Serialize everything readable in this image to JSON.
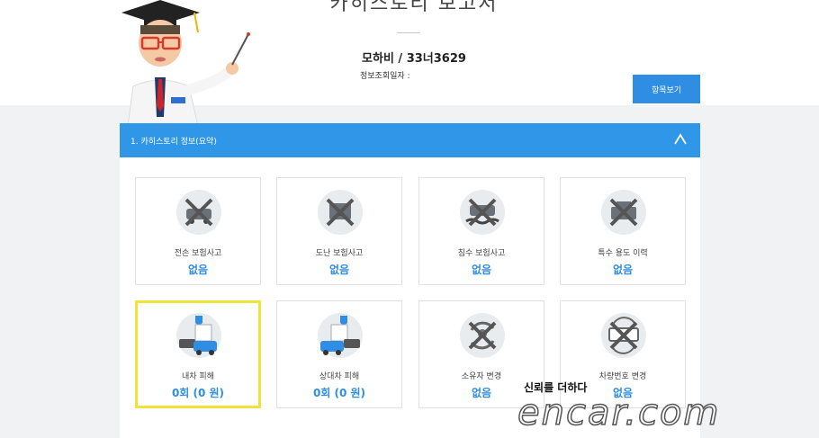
{
  "header": {
    "report_title": "카히스토리 보고서",
    "car_model_plate": "모하비 / 33너3629",
    "inquiry_date_label": "정보조회일자 :",
    "view_items_button": "항목보기"
  },
  "section": {
    "title": "1. 카히스토리 정보(요약)"
  },
  "cards": [
    {
      "label": "전손 보험사고",
      "value": "없음",
      "icon": "total-loss-icon"
    },
    {
      "label": "도난 보험사고",
      "value": "없음",
      "icon": "theft-icon"
    },
    {
      "label": "침수 보험사고",
      "value": "없음",
      "icon": "flood-icon"
    },
    {
      "label": "특수 용도 이력",
      "value": "없음",
      "icon": "special-use-icon"
    },
    {
      "label": "내차 피해",
      "value": "0회 (0 원)",
      "icon": "my-car-damage-icon"
    },
    {
      "label": "상대차 피해",
      "value": "0회 (0 원)",
      "icon": "other-car-damage-icon"
    },
    {
      "label": "소유자 변경",
      "value": "없음",
      "icon": "owner-change-icon"
    },
    {
      "label": "차량번호 변경",
      "value": "없음",
      "icon": "plate-change-icon"
    }
  ],
  "watermark": {
    "slogan": "신뢰를 더하다",
    "logo": "encar.com"
  },
  "colors": {
    "accent": "#2f96e8",
    "value_text": "#2f8de4",
    "highlight": "#f0e33c"
  }
}
